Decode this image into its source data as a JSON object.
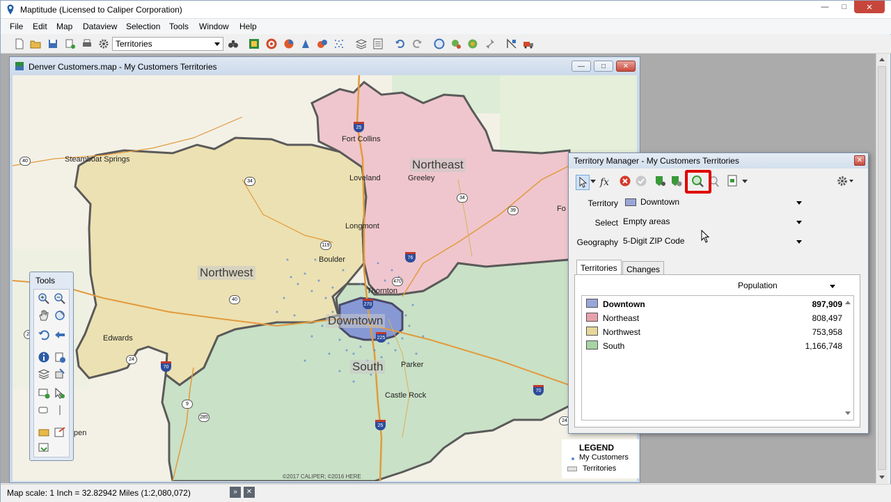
{
  "app": {
    "title": "Maptitude (Licensed to Caliper Corporation)",
    "controls": {
      "minimize": "—",
      "maximize": "□",
      "close": "✕"
    }
  },
  "menu": [
    "File",
    "Edit",
    "Map",
    "Dataview",
    "Selection",
    "Tools",
    "Window",
    "Help"
  ],
  "toolbar": {
    "layer_select": "Territories",
    "icons": [
      "new-icon",
      "open-icon",
      "save-icon",
      "print-setup-icon",
      "print-icon",
      "settings-icon",
      "binoculars-icon",
      "chart-icon",
      "color-theme-icon",
      "pie-icon",
      "dot-density-icon",
      "theme-icon",
      "scatter-icon",
      "layers-icon",
      "legend-icon",
      "undo-icon",
      "redo-icon",
      "globe-icon",
      "locate-icon",
      "territory-icon",
      "pushpin-icon",
      "route-icon",
      "delivery-icon"
    ]
  },
  "map_window": {
    "title": "Denver Customers.map - My Customers Territories",
    "copyright": "©2017 CALIPER; ©2016 HERE",
    "territories": [
      "Northeast",
      "Northwest",
      "Downtown",
      "South"
    ],
    "places": [
      "Fort Collins",
      "Loveland",
      "Greeley",
      "Steamboat Springs",
      "Longmont",
      "Boulder",
      "Thornton",
      "Edwards",
      "Parker",
      "Castle Rock",
      "Fo",
      "pen"
    ],
    "highways": [
      "40",
      "34",
      "34",
      "39",
      "119",
      "40",
      "24",
      "9",
      "285",
      "24",
      "470",
      "24"
    ],
    "interstates": [
      "25",
      "76",
      "270",
      "225",
      "70",
      "70",
      "25",
      "70"
    ],
    "colors": {
      "northeast": "#eec5cc",
      "northwest": "#ecdfad",
      "downtown": "#8a9bd4",
      "south": "#c8e0c4",
      "customer_dot": "#5b8bd4"
    }
  },
  "legend": {
    "title": "LEGEND",
    "items": [
      "My Customers",
      "Territories"
    ]
  },
  "tools": {
    "title": "Tools",
    "icons": [
      "zoom-in-icon",
      "zoom-out-icon",
      "pan-icon",
      "rotate-icon",
      "undo-view-icon",
      "back-icon",
      "info-icon",
      "select-info-icon",
      "layers-tool-icon",
      "select-tool-icon",
      "add-point-icon",
      "pointer-select-icon",
      "label-icon",
      "ruler-icon",
      "legend-tool-icon",
      "export-icon"
    ]
  },
  "territory_manager": {
    "title": "Territory Manager - My Customers Territories",
    "close": "✕",
    "toolbar_icons": [
      "select-tool-icon",
      "formula-icon",
      "delete-icon",
      "accept-icon",
      "territory-add-icon",
      "territory-settings-icon",
      "zoom-territory-icon",
      "zoom-out-territory-icon",
      "report-icon",
      "gear-icon"
    ],
    "territory_label": "Territory",
    "territory_value": "Downtown",
    "select_label": "Select",
    "select_value": "Empty areas",
    "geography_label": "Geography",
    "geography_value": "5-Digit ZIP Code",
    "tabs": [
      "Territories",
      "Changes"
    ],
    "column_select": "Population",
    "rows": [
      {
        "name": "Downtown",
        "value": "897,909",
        "color": "#9aa6d8"
      },
      {
        "name": "Northeast",
        "value": "808,497",
        "color": "#e7a0ab"
      },
      {
        "name": "Northwest",
        "value": "753,958",
        "color": "#e6d899"
      },
      {
        "name": "South",
        "value": "1,166,748",
        "color": "#a9d3a5"
      }
    ]
  },
  "status": {
    "text": "Map scale: 1 Inch = 32.82942 Miles (1:2,080,072)",
    "btn_expand": "»",
    "btn_close": "✕"
  }
}
